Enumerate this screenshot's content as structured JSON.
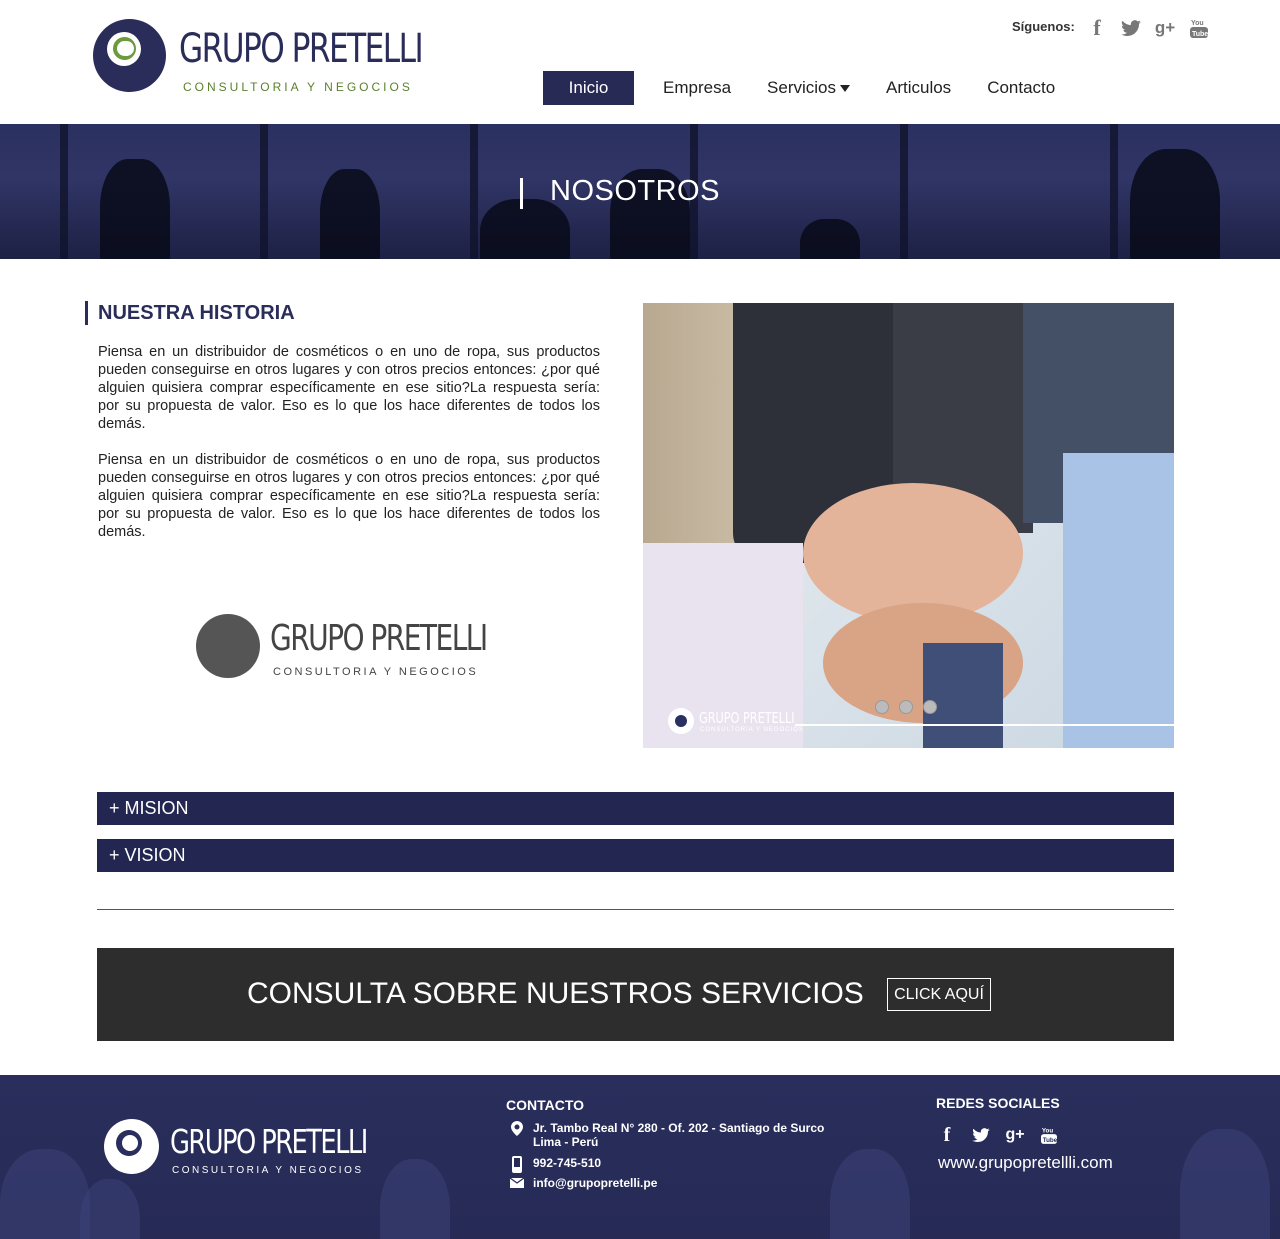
{
  "header": {
    "logo_title": "GRUPO PRETELLI",
    "logo_subtitle": "CONSULTORIA Y NEGOCIOS",
    "follow_label": "Síguenos:",
    "social": [
      {
        "icon": "facebook-icon",
        "glyph": "f"
      },
      {
        "icon": "twitter-icon",
        "glyph": "🐦"
      },
      {
        "icon": "google-plus-icon",
        "glyph": "g+"
      },
      {
        "icon": "youtube-icon",
        "glyph": "▶"
      }
    ],
    "nav": [
      "Inicio",
      "Empresa",
      "Servicios",
      "Articulos",
      "Contacto"
    ]
  },
  "banner": {
    "title": "NOSOTROS"
  },
  "historia": {
    "title": "NUESTRA HISTORIA",
    "paragraphs": [
      "Piensa en un distribuidor de cosméticos o en uno de ropa, sus productos pueden conseguirse en otros lugares y con otros precios entonces: ¿por qué alguien quisiera comprar específicamente en ese sitio?La respuesta sería: por su propuesta de valor. Eso es lo que los hace diferentes de todos los demás.",
      "Piensa en un distribuidor de cosméticos o en uno de ropa, sus productos pueden conseguirse en otros lugares y con otros precios entonces: ¿por qué alguien quisiera comprar específicamente en ese sitio?La respuesta sería: por su propuesta de valor. Eso es lo que los hace diferentes de todos los demás."
    ],
    "logo_title": "GRUPO PRETELLI",
    "logo_subtitle": "CONSULTORIA Y NEGOCIOS"
  },
  "slider": {
    "logo_title": "GRUPO PRETELLI",
    "logo_subtitle": "CONSULTORIA Y NEGOCIOS",
    "slide_count": 3
  },
  "accordion": [
    "+ MISION",
    "+ VISION"
  ],
  "cta": {
    "text": "CONSULTA SOBRE NUESTROS SERVICIOS",
    "button": "CLICK AQUÍ"
  },
  "footer": {
    "logo_title": "GRUPO PRETELLI",
    "logo_subtitle": "CONSULTORIA Y NEGOCIOS",
    "contact_heading": "CONTACTO",
    "address_line1": "Jr. Tambo Real N° 280 - Of. 202 - Santiago de Surco",
    "address_line2": "Lima - Perú",
    "phone": "992-745-510",
    "email": "info@grupopretelli.pe",
    "social_heading": "REDES SOCIALES",
    "website": "www.grupopretellli.com"
  },
  "colors": {
    "brand_navy": "#262a55",
    "brand_green": "#6d9a3a",
    "cta_bg": "#2d2d2d"
  }
}
